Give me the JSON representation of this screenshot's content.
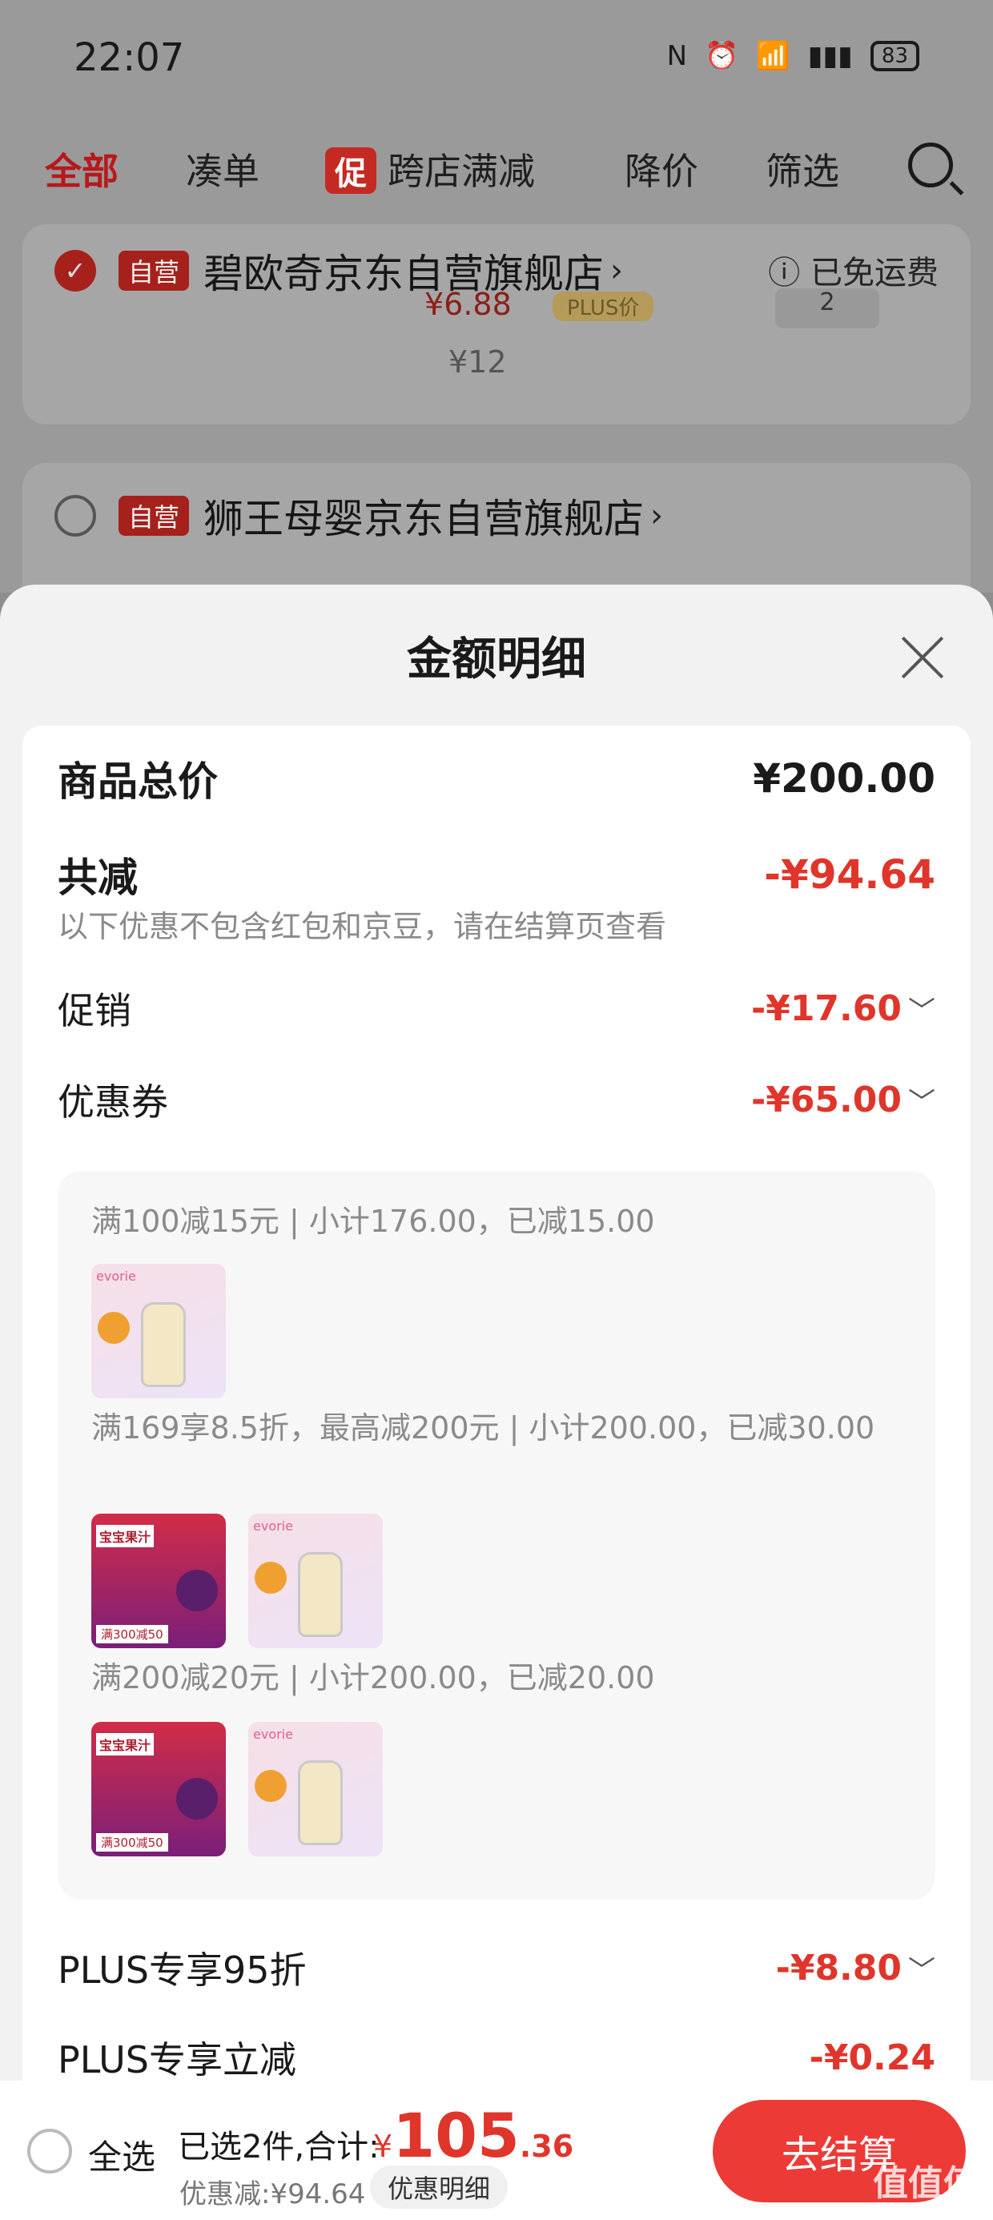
{
  "status": {
    "time": "22:07",
    "battery": "83"
  },
  "tabs": {
    "all": "全部",
    "combo": "凑单",
    "promo_badge": "促",
    "cross_store": "跨店满减",
    "price_drop": "降价",
    "filter": "筛选"
  },
  "stores": [
    {
      "name": "碧欧奇京东自营旗舰店",
      "self_operated": "自营",
      "shipping": "已免运费",
      "partial_price": "¥6.88",
      "partial_plus": "PLUS价",
      "old_price": "¥12",
      "qty": "2"
    },
    {
      "name": "狮王母婴京东自营旗舰店",
      "self_operated": "自营"
    }
  ],
  "sheet": {
    "title": "金额明细",
    "total_label": "商品总价",
    "total_value": "¥200.00",
    "reduced_label": "共减",
    "reduced_value": "-¥94.64",
    "note": "以下优惠不包含红包和京豆，请在结算页查看",
    "promo_label": "促销",
    "promo_value": "-¥17.60",
    "coupon_label": "优惠券",
    "coupon_value": "-¥65.00",
    "coupons": [
      {
        "text": "满100减15元 | 小计176.00，已减15.00",
        "items": [
          "bottle"
        ]
      },
      {
        "text": "满169享8.5折，最高减200元 | 小计200.00，已减30.00",
        "items": [
          "juice",
          "bottle"
        ]
      },
      {
        "text": "满200减20元 | 小计200.00，已减20.00",
        "items": [
          "juice",
          "bottle"
        ]
      }
    ],
    "plus95_label": "PLUS专享95折",
    "plus95_value": "-¥8.80",
    "plus_instant_label": "PLUS专享立减",
    "plus_instant_value": "-¥0.24"
  },
  "product_art": {
    "bottle_brand": "evorie",
    "juice_title": "宝宝果汁",
    "juice_badge": "满300减50"
  },
  "bottom": {
    "select_all": "全选",
    "selected": "已选2件,合计:",
    "currency": "¥",
    "total_int": "105",
    "total_dec": ".36",
    "discount": "优惠减:¥94.64",
    "detail": "优惠明细",
    "checkout": "去结算"
  },
  "watermark": "值值值"
}
